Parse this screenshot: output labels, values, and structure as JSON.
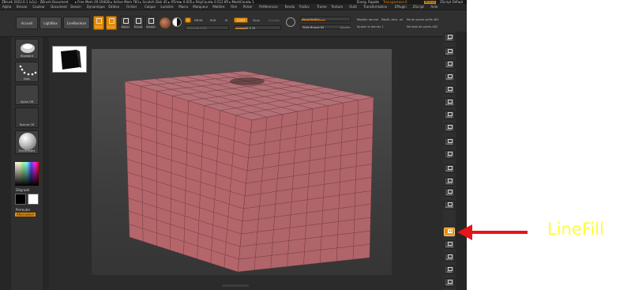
{
  "titlebar": {
    "app_title": "ZBrush 2022.0.1 (x1s) · ZBrush Document",
    "stats": "▸ Free Mem 29.194GB ▸ Active Mem 783 ▸ Scratch Disk 45 ▸ ATime▸ 0.005 ▸ PolyCount▸ 0.512 KP ▸ MeshCount▸ 1",
    "quick_save": "QuickSave",
    "energy": "Énerg. Rapide",
    "transparency": "Transparence 0",
    "menus_btn": "Menus",
    "script": "ZScript Défaut"
  },
  "menubar": {
    "items": [
      "Alpha",
      "Brosse",
      "Couleur",
      "Document",
      "Dessin",
      "Dynamique",
      "Édition",
      "Fichier",
      "Calque",
      "Lumière",
      "Macro",
      "Marqueur",
      "Matière",
      "Film",
      "Picker",
      "Préférences",
      "Rendu",
      "Traitsv",
      "Trame",
      "Texture",
      "Outil",
      "Transformation",
      "ZPlugin",
      "ZScript",
      "Aide"
    ]
  },
  "toolbar": {
    "home": "Accueil",
    "lightbox": "LightBox",
    "livebool": "LiveBoolean",
    "edit": "Éditer",
    "draw": "Dessin",
    "move": "Déplac.",
    "scale": "Échelle",
    "rotate": "Rotation",
    "a_btn": "A",
    "mrgb": "MRGB",
    "rgb": "RGB",
    "m": "M",
    "zadd": "Zadd",
    "zsub": "Zsub",
    "zcut": "Zcouper",
    "rgb_intensity": "Intensité RGB",
    "z_intensity": "Intensité Z 25",
    "focal": "Focal Shift 0",
    "draw_size": "Taille Brosse 64",
    "dynamic": "Dynamic",
    "replay_last": "Répéter dernier",
    "replay_rel": "Répét. dern. rel",
    "points_sel": "Nb de points actifs 482",
    "adjust_last": "Ajuster le dernier 1",
    "points_total": "Nb total de points 482"
  },
  "left_panel": {
    "brush": "Standard",
    "stroke": "Dots",
    "alpha": "Alpha Off",
    "texture": "Texture Off",
    "material": "SkinShade4",
    "gradient": "Dégradé",
    "switch_color": "Permuter",
    "alternate": "Alternative"
  },
  "right_shelf": {
    "items": [
      "BPR",
      "Spix 3",
      "Scroll",
      "Zoom",
      "Actual",
      "AAHalf",
      "Persp",
      "Floor",
      "Local",
      "Sym",
      "Frame",
      "Move",
      "Scale",
      "Rotate",
      "LineFill",
      "Transp",
      "Ghost",
      "Solo",
      "Xpose"
    ],
    "linefill_active": true
  },
  "annotation": {
    "label": "LineFill",
    "arrow_color": "#e8141b",
    "label_color": "#ffff33"
  },
  "colors": {
    "accent": "#e68a00",
    "mesh": "#b5666b",
    "wire": "#6e3a3d"
  }
}
